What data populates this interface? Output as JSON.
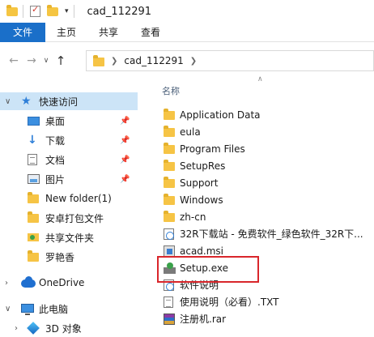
{
  "window": {
    "title": "cad_112291"
  },
  "ribbon": {
    "tabs": [
      "文件",
      "主页",
      "共享",
      "查看"
    ]
  },
  "address": {
    "path": "cad_112291"
  },
  "sidebar": {
    "quick_access_label": "快速访问",
    "items": [
      {
        "label": "桌面",
        "pinned": true
      },
      {
        "label": "下载",
        "pinned": true
      },
      {
        "label": "文档",
        "pinned": true
      },
      {
        "label": "图片",
        "pinned": true
      },
      {
        "label": "New folder(1)",
        "pinned": false
      },
      {
        "label": "安卓打包文件",
        "pinned": false
      },
      {
        "label": "共享文件夹",
        "pinned": false
      },
      {
        "label": "罗艳香",
        "pinned": false
      }
    ],
    "onedrive_label": "OneDrive",
    "thispc_label": "此电脑",
    "thispc_items": [
      "3D 对象"
    ]
  },
  "content": {
    "column_name": "名称",
    "files": [
      {
        "name": "Application Data",
        "type": "folder"
      },
      {
        "name": "eula",
        "type": "folder"
      },
      {
        "name": "Program Files",
        "type": "folder"
      },
      {
        "name": "SetupRes",
        "type": "folder"
      },
      {
        "name": "Support",
        "type": "folder"
      },
      {
        "name": "Windows",
        "type": "folder"
      },
      {
        "name": "zh-cn",
        "type": "folder"
      },
      {
        "name": "32R下载站 - 免费软件_绿色软件_32R下...",
        "type": "web"
      },
      {
        "name": "acad.msi",
        "type": "msi"
      },
      {
        "name": "Setup.exe",
        "type": "setup"
      },
      {
        "name": "软件说明",
        "type": "web"
      },
      {
        "name": "使用说明（必看）.TXT",
        "type": "txt"
      },
      {
        "name": "注册机.rar",
        "type": "rar"
      }
    ],
    "highlighted": "Setup.exe"
  },
  "colors": {
    "file_tab": "#1a6fc9",
    "selection": "#cce4f7",
    "highlight_border": "#d9262b"
  }
}
